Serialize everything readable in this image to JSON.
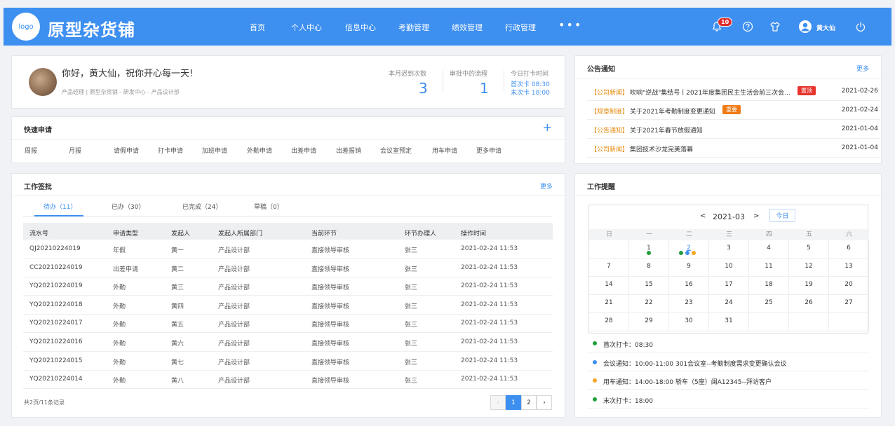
{
  "header": {
    "logo": "logo",
    "brand": "原型杂货铺",
    "nav": [
      "首页",
      "个人中心",
      "信息中心",
      "考勤管理",
      "绩效管理",
      "行政管理"
    ],
    "nav_more": "•••",
    "notification_count": "10",
    "user_name": "黄大仙",
    "icons": [
      "bell-icon",
      "help-icon",
      "skin-icon",
      "user-icon",
      "power-icon"
    ]
  },
  "welcome": {
    "greeting": "你好，黄大仙，祝你开心每一天!",
    "subtitle": "产品经理 | 原型杂货铺 - 研发中心 - 产品设计部",
    "late_label": "本月迟到次数",
    "late_value": "3",
    "pending_label": "审批中的流程",
    "pending_value": "1",
    "clock_label": "今日打卡时间",
    "first_clock": "首次卡 08:30",
    "last_clock": "末次卡 18:00"
  },
  "quick": {
    "title": "快速申请",
    "add_icon": "+",
    "items": [
      "周报",
      "月报",
      "请假申请",
      "打卡申请",
      "加班申请",
      "外勤申请",
      "出差申请",
      "出差报销",
      "会议室预定",
      "用车申请",
      "更多申请"
    ]
  },
  "approval": {
    "title": "工作签批",
    "more": "更多",
    "tabs": [
      "待办（11）",
      "已办（30）",
      "已完成（24）",
      "草稿（0）"
    ],
    "columns": [
      "流水号",
      "申请类型",
      "发起人",
      "发起人所属部门",
      "当前环节",
      "环节办理人",
      "操作时间"
    ],
    "rows": [
      [
        "QJ20210224019",
        "年假",
        "黄一",
        "产品设计部",
        "直接领导审核",
        "张三",
        "2021-02-24 11:53"
      ],
      [
        "CC20210224019",
        "出差申请",
        "黄二",
        "产品设计部",
        "直接领导审核",
        "张三",
        "2021-02-24 11:53"
      ],
      [
        "YQ20210224019",
        "外勤",
        "黄三",
        "产品设计部",
        "直接领导审核",
        "张三",
        "2021-02-24 11:53"
      ],
      [
        "YQ20210224018",
        "外勤",
        "黄四",
        "产品设计部",
        "直接领导审核",
        "张三",
        "2021-02-24 11:53"
      ],
      [
        "YQ20210224017",
        "外勤",
        "黄五",
        "产品设计部",
        "直接领导审核",
        "张三",
        "2021-02-24 11:53"
      ],
      [
        "YQ20210224016",
        "外勤",
        "黄六",
        "产品设计部",
        "直接领导审核",
        "张三",
        "2021-02-24 11:53"
      ],
      [
        "YQ20210224015",
        "外勤",
        "黄七",
        "产品设计部",
        "直接领导审核",
        "张三",
        "2021-02-24 11:53"
      ],
      [
        "YQ20210224014",
        "外勤",
        "黄八",
        "产品设计部",
        "直接领导审核",
        "张三",
        "2021-02-24 11:53"
      ]
    ],
    "summary": "共2页/11条记录",
    "pager": {
      "prev": "‹",
      "pages": [
        "1",
        "2"
      ],
      "next": "›"
    }
  },
  "notice": {
    "title": "公告通知",
    "more": "更多",
    "items": [
      {
        "tag": "【公司新闻】",
        "title": "吹响\"逆战\"集结号丨2021年度集团民主生活会前三次会...",
        "badge": "置顶",
        "badge_color": "#e6342d",
        "date": "2021-02-26"
      },
      {
        "tag": "【规章制度】",
        "title": "关于2021年考勤制度变更通知",
        "badge": "重要",
        "badge_color": "#f07a14",
        "date": "2021-02-24"
      },
      {
        "tag": "【公告通知】",
        "title": "关于2021年春节放假通知",
        "badge": "",
        "date": "2021-01-04"
      },
      {
        "tag": "【公司新闻】",
        "title": "集团技术沙龙完美落幕",
        "badge": "",
        "date": "2021-01-04"
      }
    ]
  },
  "reminder": {
    "title": "工作提醒",
    "calendar": {
      "prev": "<",
      "month": "2021-03",
      "next": ">",
      "today": "今日",
      "weekdays": [
        "日",
        "一",
        "二",
        "三",
        "四",
        "五",
        "六"
      ],
      "weeks": [
        [
          "",
          "1",
          "2",
          "3",
          "4",
          "5",
          "6"
        ],
        [
          "7",
          "8",
          "9",
          "10",
          "11",
          "12",
          "13"
        ],
        [
          "14",
          "15",
          "16",
          "17",
          "18",
          "19",
          "20"
        ],
        [
          "21",
          "22",
          "23",
          "24",
          "25",
          "26",
          "27"
        ],
        [
          "28",
          "29",
          "30",
          "31",
          "",
          "",
          ""
        ]
      ]
    },
    "events": [
      {
        "text": "首次打卡：08:30",
        "color": "#1e9e3a"
      },
      {
        "text": "会议通知：10:00-11:00  301会议室--考勤制度需求变更确认会议",
        "color": "#3d8ff0"
      },
      {
        "text": "用车通知：14:00-18:00  轿车（5座）闽A12345--拜访客户",
        "color": "#f5a623"
      },
      {
        "text": "末次打卡：18:00",
        "color": "#1e9e3a"
      }
    ]
  }
}
